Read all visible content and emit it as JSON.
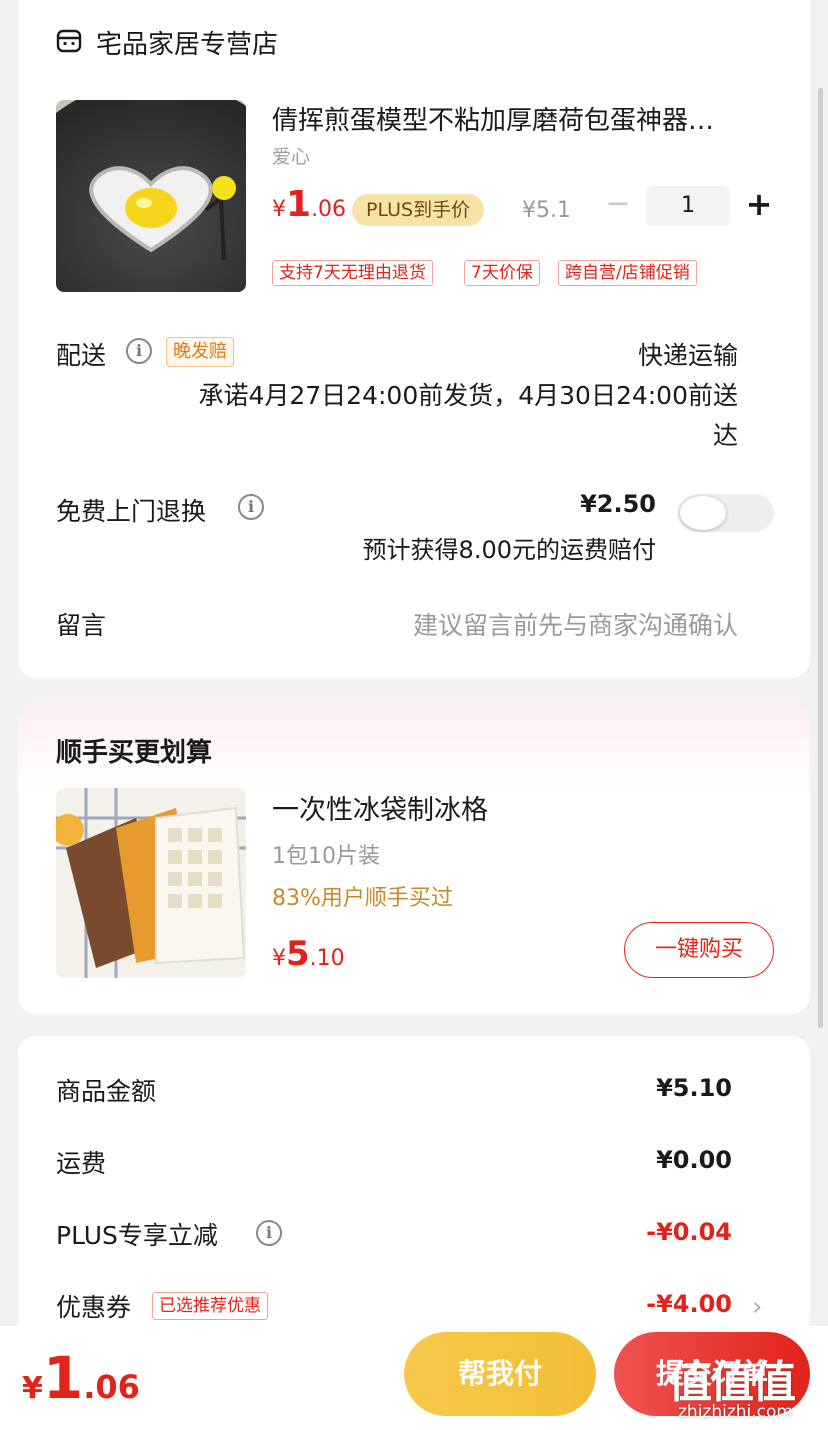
{
  "store": {
    "name": "宅品家居专营店",
    "icon": "store-icon"
  },
  "product": {
    "title": "倩挥煎蛋模型不粘加厚磨荷包蛋神器…",
    "variant": "爱心",
    "price_currency": "¥",
    "price_int": "1",
    "price_dec": ".06",
    "plus_badge": "PLUS到手价",
    "original_price": "¥5.1",
    "minus": "−",
    "quantity": "1",
    "plus": "+",
    "tags": [
      "支持7天无理由退货",
      "7天价保",
      "跨自营/店铺促销"
    ]
  },
  "delivery": {
    "label": "配送",
    "badge": "晚发赔",
    "method": "快递运输",
    "promise_line1": "承诺4月27日24:00前发货，4月30日24:00前送",
    "promise_line2": "达"
  },
  "return_service": {
    "label": "免费上门退换",
    "price": "¥2.50",
    "desc": "预计获得8.00元的运费赔付",
    "enabled": false
  },
  "message": {
    "label": "留言",
    "placeholder": "建议留言前先与商家沟通确认"
  },
  "recommend": {
    "section_title": "顺手买更划算",
    "title": "一次性冰袋制冰格",
    "spec": "1包10片装",
    "bought_pct": "83%用户顺手买过",
    "price_currency": "¥",
    "price_int": "5",
    "price_dec": ".10",
    "buy_label": "一键购买"
  },
  "summary": {
    "goods_label": "商品金额",
    "goods_value": "¥5.10",
    "shipping_label": "运费",
    "shipping_value": "¥0.00",
    "plus_label": "PLUS专享立减",
    "plus_value": "-¥0.04",
    "coupon_label": "优惠券",
    "coupon_badge": "已选推荐优惠",
    "coupon_value": "-¥4.00",
    "chevron": "›"
  },
  "bottom": {
    "total_currency": "¥",
    "total_int": "1",
    "total_dec": ".06",
    "help_pay": "帮我付",
    "submit": "提交订单"
  },
  "watermark": {
    "main": "值值值",
    "sub": "zhizhizhi.com"
  },
  "colors": {
    "accent_red": "#e2231a",
    "plus_gold": "#f8e3a6",
    "help_yellow": "#f3be35",
    "orange_text": "#c88a2a"
  }
}
